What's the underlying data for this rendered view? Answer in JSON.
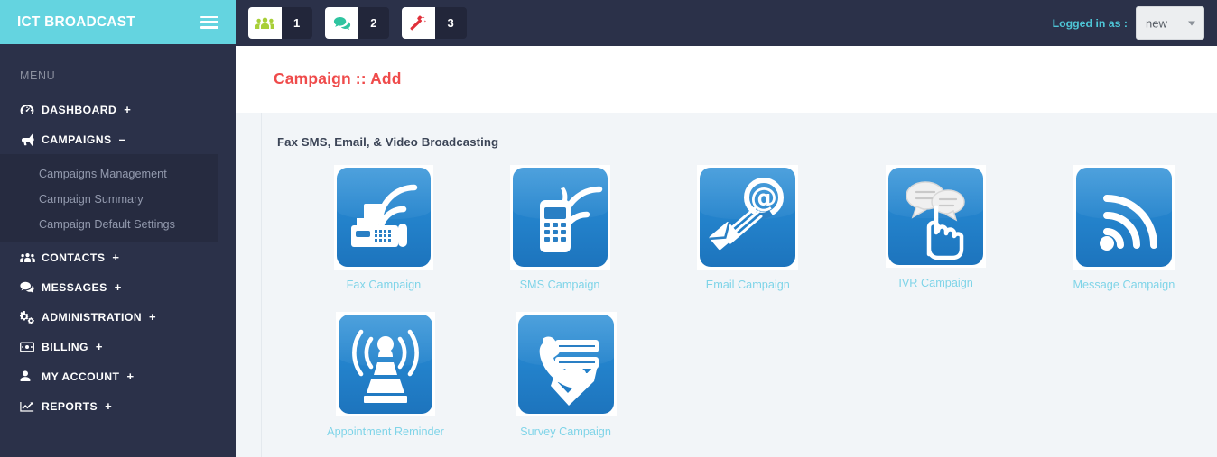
{
  "brand": {
    "title": "ICT BROADCAST",
    "menu_icon": "hamburger-icon"
  },
  "sidebar": {
    "menu_label": "MENU",
    "items": [
      {
        "label": "DASHBOARD",
        "icon": "dashboard-icon",
        "toggle": "+",
        "expanded": false
      },
      {
        "label": "CAMPAIGNS",
        "icon": "megaphone-icon",
        "toggle": "–",
        "expanded": true
      },
      {
        "label": "CONTACTS",
        "icon": "contacts-icon",
        "toggle": "+",
        "expanded": false
      },
      {
        "label": "MESSAGES",
        "icon": "messages-icon",
        "toggle": "+",
        "expanded": false
      },
      {
        "label": "ADMINISTRATION",
        "icon": "gears-icon",
        "toggle": "+",
        "expanded": false
      },
      {
        "label": "BILLING",
        "icon": "billing-icon",
        "toggle": "+",
        "expanded": false
      },
      {
        "label": "MY ACCOUNT",
        "icon": "user-icon",
        "toggle": "+",
        "expanded": false
      },
      {
        "label": "REPORTS",
        "icon": "chart-line-icon",
        "toggle": "+",
        "expanded": false
      }
    ],
    "submenu": [
      {
        "label": "Campaigns Management"
      },
      {
        "label": "Campaign Summary"
      },
      {
        "label": "Campaign Default Settings"
      }
    ]
  },
  "topbar": {
    "badges": [
      {
        "icon": "users-icon",
        "count": "1",
        "color": "#a8cf38"
      },
      {
        "icon": "comments-icon",
        "count": "2",
        "color": "#2fc4a0"
      },
      {
        "icon": "magic-wand-icon",
        "count": "3",
        "color": "#e0303a"
      }
    ],
    "login_label": "Logged in as :",
    "user_value": "new",
    "user_caret": "chevron-down-icon"
  },
  "main": {
    "page_title": "Campaign :: Add",
    "panel_heading": "Fax SMS, Email, & Video Broadcasting",
    "tiles_row1": [
      {
        "label": "Fax Campaign",
        "icon": "fax-campaign-icon"
      },
      {
        "label": "SMS Campaign",
        "icon": "sms-campaign-icon"
      },
      {
        "label": "Email Campaign",
        "icon": "email-campaign-icon"
      },
      {
        "label": "IVR Campaign",
        "icon": "ivr-campaign-icon"
      },
      {
        "label": "Message Campaign",
        "icon": "message-campaign-icon"
      }
    ],
    "tiles_row2": [
      {
        "label": "Appointment Reminder",
        "icon": "appointment-reminder-icon"
      },
      {
        "label": "Survey Campaign",
        "icon": "survey-campaign-icon"
      }
    ]
  },
  "colors": {
    "brand_bg": "#64d4e0",
    "sidebar_bg": "#2b3149",
    "submenu_bg": "#262b40",
    "title_red": "#ef4b4b",
    "link_cyan": "#7fd4e8",
    "tile_blue": "#2484cd",
    "content_bg": "#f2f5f8"
  }
}
